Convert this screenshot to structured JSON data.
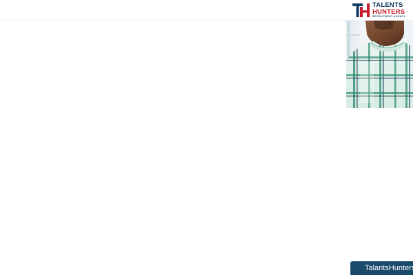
{
  "header": {
    "logo": {
      "line1": "TALENTS",
      "line2": "HUNTERS",
      "line3": "RECRUITMENT AGENCY",
      "brand_blue": "#123a62",
      "brand_red": "#c8202f"
    }
  },
  "hero": {
    "image": "man-in-plaid-shirt-photo"
  },
  "chat": {
    "label": "TalantsHunters",
    "background": "#1a4a6b"
  }
}
